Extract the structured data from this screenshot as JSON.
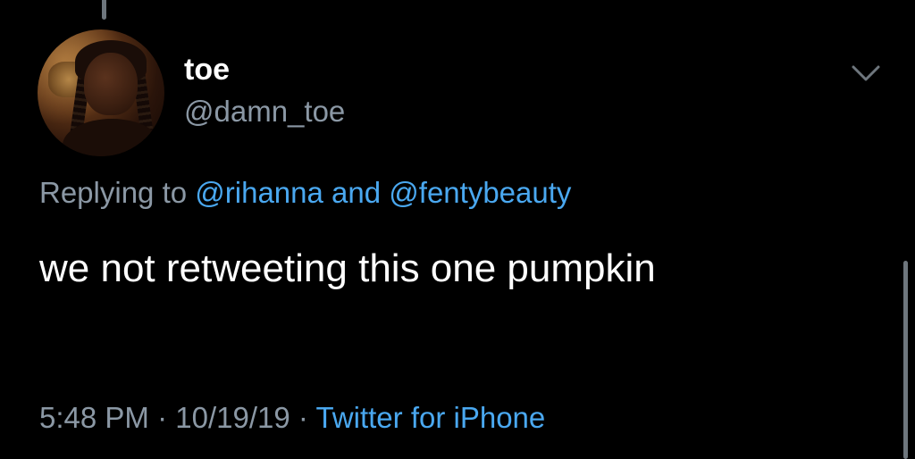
{
  "tweet": {
    "display_name": "toe",
    "handle": "@damn_toe",
    "avatar_icon": "profile-photo",
    "reply": {
      "prefix": "Replying to",
      "mention_1": "@rihanna",
      "conjunction": "and",
      "mention_2": "@fentybeauty"
    },
    "text": "we not retweeting this one pumpkin",
    "time": "5:48 PM",
    "separator_1": "·",
    "date": "10/19/19",
    "separator_2": "·",
    "source": "Twitter for iPhone"
  },
  "icons": {
    "more": "chevron-down-icon"
  },
  "colors": {
    "background": "#000000",
    "primary_text": "#ffffff",
    "secondary_text": "#8b98a5",
    "link": "#4aa8f0",
    "thread_line": "#6e767d"
  }
}
